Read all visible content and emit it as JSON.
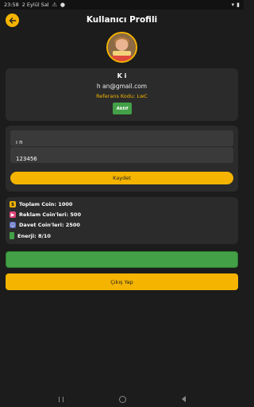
{
  "status_bar": {
    "time": "23:58",
    "date": "2 Eylül Sal",
    "icons": [
      "notification-icon",
      "warning-icon",
      "wifi-icon",
      "battery-icon"
    ]
  },
  "header": {
    "title": "Kullanıcı Profili",
    "back_icon": "arrow-left-icon"
  },
  "profile": {
    "name": "K          i",
    "email": "h             an@gmail.com",
    "referral": "Referans Kodu: LwC",
    "status": "Aktif"
  },
  "form": {
    "name_label": "",
    "name_value": "ı       n",
    "phone_label": "",
    "phone_value": "123456",
    "save_label": "Kaydet"
  },
  "stats": [
    {
      "icon": "coin-bag-icon",
      "text": "Toplam Coin: 1000"
    },
    {
      "icon": "video-icon",
      "text": "Reklam Coin'leri: 500"
    },
    {
      "icon": "invite-user-icon",
      "text": "Davet Coin'leri: 2500"
    },
    {
      "icon": "battery-icon",
      "text": "Enerji: 8/10"
    }
  ],
  "buttons": {
    "green_label": "",
    "logout_label": "Çıkış Yap"
  },
  "colors": {
    "accent": "#f4b400",
    "success": "#43a047",
    "background": "#1c1c1c",
    "card": "#2b2b2b"
  }
}
